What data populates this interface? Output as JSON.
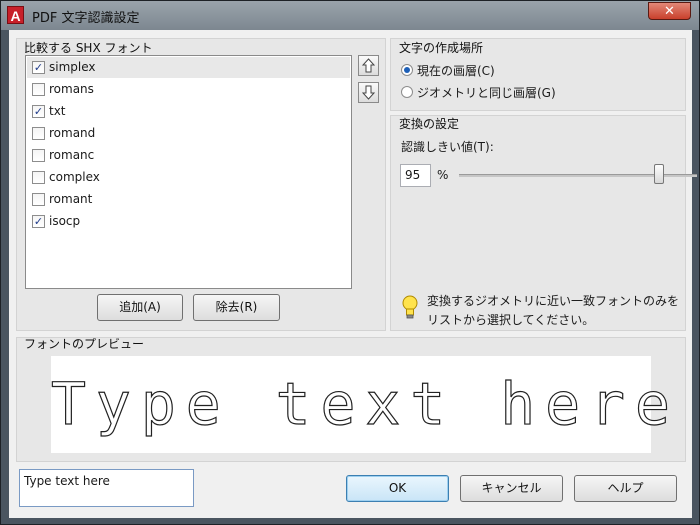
{
  "window": {
    "app_icon_letter": "A",
    "title": "PDF 文字認識設定",
    "close_glyph": "✕"
  },
  "shx_group": {
    "label": "比較する SHX フォント",
    "items": [
      {
        "label": "simplex",
        "checked": true,
        "selected": true
      },
      {
        "label": "romans",
        "checked": false
      },
      {
        "label": "txt",
        "checked": true
      },
      {
        "label": "romand",
        "checked": false
      },
      {
        "label": "romanc",
        "checked": false
      },
      {
        "label": "complex",
        "checked": false
      },
      {
        "label": "romant",
        "checked": false
      },
      {
        "label": "isocp",
        "checked": true
      }
    ],
    "move_up_icon": "arrow-up-icon",
    "move_down_icon": "arrow-down-icon",
    "add_label": "追加(A)",
    "remove_label": "除去(R)"
  },
  "placement_group": {
    "label": "文字の作成場所",
    "options": [
      {
        "label": "現在の画層(C)",
        "selected": true
      },
      {
        "label": "ジオメトリと同じ画層(G)",
        "selected": false
      }
    ]
  },
  "conversion_group": {
    "label": "変換の設定",
    "threshold_label": "認識しきい値(T):",
    "threshold_value": "95",
    "threshold_unit": "%",
    "slider_fraction": 0.95,
    "hint_line1": "変換するジオメトリに近い一致フォントのみを",
    "hint_line2": "リストから選択してください。",
    "hint_icon": "lightbulb-icon"
  },
  "preview_group": {
    "label": "フォントのプレビュー",
    "preview_text": "Type text here"
  },
  "footer": {
    "text_input_value": "Type text here",
    "ok_label": "OK",
    "cancel_label": "キャンセル",
    "help_label": "ヘルプ"
  }
}
